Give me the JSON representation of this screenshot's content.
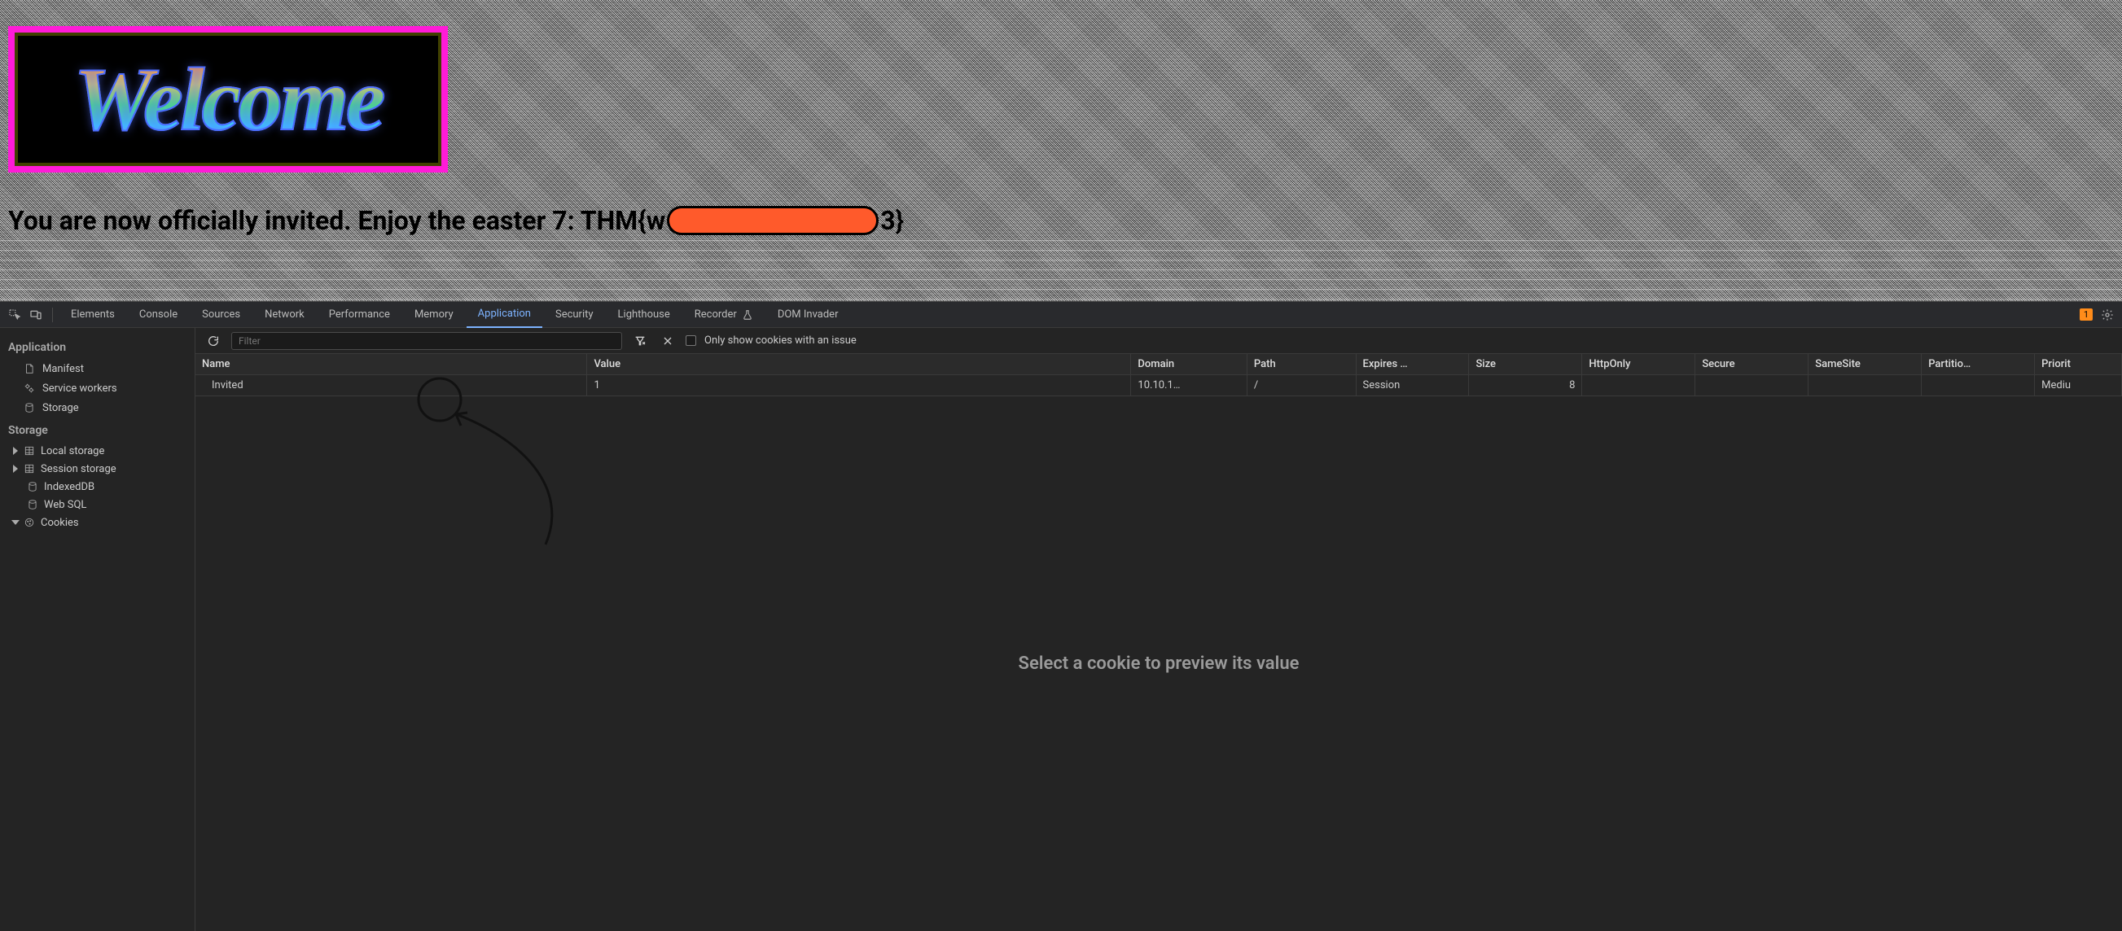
{
  "page": {
    "welcome": "Welcome",
    "flag_prefix": "You are now officially invited. Enjoy the easter 7: THM{w",
    "flag_suffix": "3}"
  },
  "devtools": {
    "tabs": [
      "Elements",
      "Console",
      "Sources",
      "Network",
      "Performance",
      "Memory",
      "Application",
      "Security",
      "Lighthouse",
      "Recorder",
      "DOM Invader"
    ],
    "active_tab": "Application",
    "issues_count": "1"
  },
  "sidebar": {
    "application_header": "Application",
    "manifest": "Manifest",
    "service_workers": "Service workers",
    "storage_item": "Storage",
    "storage_header": "Storage",
    "local_storage": "Local storage",
    "session_storage": "Session storage",
    "indexeddb": "IndexedDB",
    "websql": "Web SQL",
    "cookies": "Cookies"
  },
  "toolbar": {
    "filter_placeholder": "Filter",
    "only_issues_label": "Only show cookies with an issue"
  },
  "table": {
    "headers": {
      "name": "Name",
      "value": "Value",
      "domain": "Domain",
      "path": "Path",
      "expires": "Expires …",
      "size": "Size",
      "httponly": "HttpOnly",
      "secure": "Secure",
      "samesite": "SameSite",
      "partition": "Partitio…",
      "priority": "Priorit"
    },
    "row": {
      "name": "Invited",
      "value": "1",
      "domain": "10.10.1…",
      "path": "/",
      "expires": "Session",
      "size": "8",
      "httponly": "",
      "secure": "",
      "samesite": "",
      "partition": "",
      "priority": "Mediu"
    }
  },
  "preview": {
    "placeholder": "Select a cookie to preview its value"
  }
}
